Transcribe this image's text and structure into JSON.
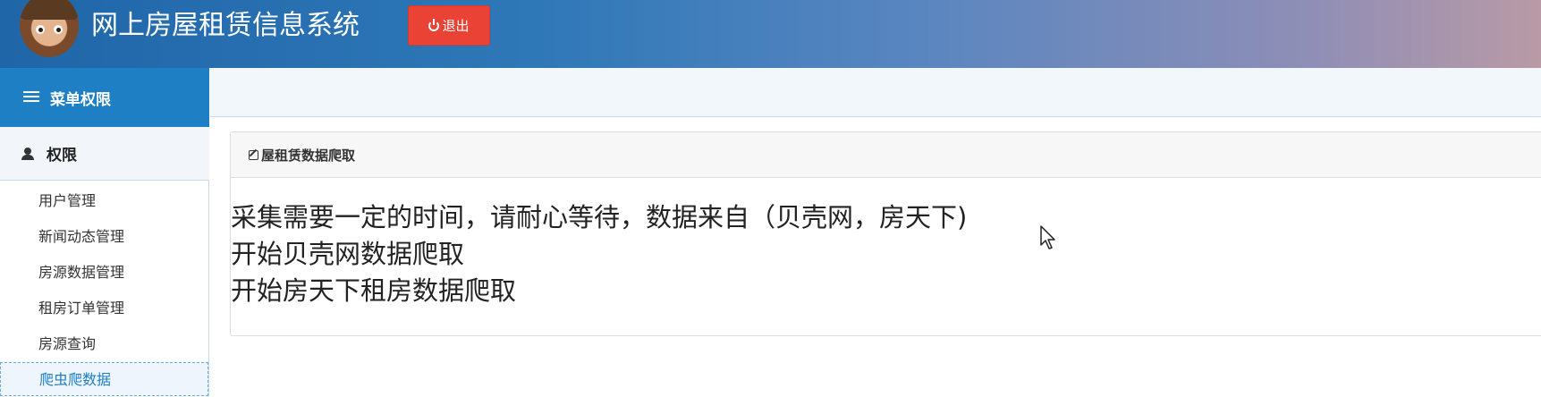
{
  "header": {
    "title": "网上房屋租赁信息系统",
    "logout_label": "退出"
  },
  "sidebar": {
    "menu_header": "菜单权限",
    "group_label": "权限",
    "items": [
      {
        "label": "用户管理"
      },
      {
        "label": "新闻动态管理"
      },
      {
        "label": "房源数据管理"
      },
      {
        "label": "租房订单管理"
      },
      {
        "label": "房源查询"
      },
      {
        "label": "爬虫爬数据"
      }
    ]
  },
  "main": {
    "panel_title": "屋租赁数据爬取",
    "messages": [
      "采集需要一定的时间，请耐心等待，数据来自（贝壳网，房天下)",
      "开始贝壳网数据爬取",
      "开始房天下租房数据爬取"
    ]
  },
  "colors": {
    "logout": "#ea4335",
    "menu_header": "#1f7fc4",
    "active_item": "#1f7fc4"
  },
  "icons": [
    "power-icon",
    "list-icon",
    "user-icon",
    "edit-icon",
    "mouse-cursor-icon"
  ]
}
